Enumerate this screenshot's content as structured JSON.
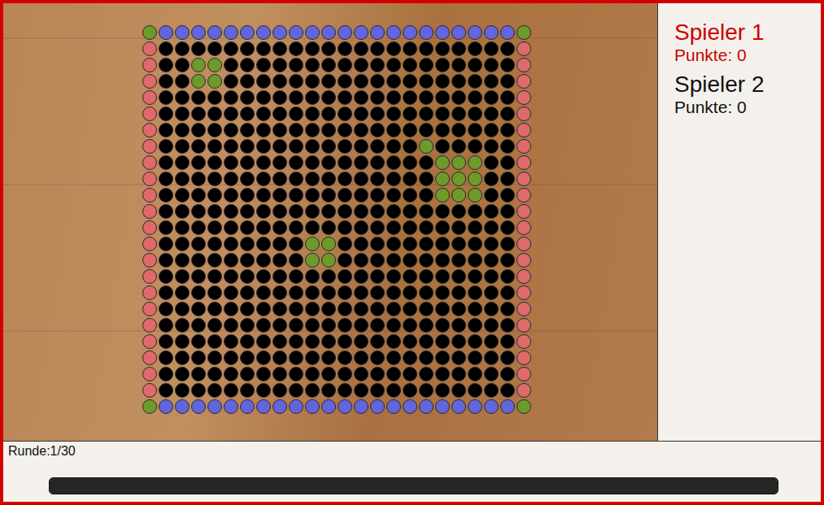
{
  "board": {
    "rows": [
      "gbbbbbbbbbbbbbbbbbbbbbbg",
      "r......................r",
      "r..gg..................r",
      "r..gg..................r",
      "r......................r",
      "r......................r",
      "r......................r",
      "r................g.....r",
      "r.................ggg..r",
      "r.................ggg..r",
      "r.................ggg..r",
      "r......................r",
      "r......................r",
      "r.........gg...........r",
      "r.........gg...........r",
      "r......................r",
      "r......................r",
      "r......................r",
      "r......................r",
      "r......................r",
      "r......................r",
      "r......................r",
      "r......................r",
      "gbbbbbbbbbbbbbbbbbbbbbbg"
    ],
    "legend": {
      "g": "#6e9a2b",
      "b": "#6464dc",
      "r": "#de6a6a",
      ".": "#000000"
    }
  },
  "players": [
    {
      "name": "Spieler 1",
      "points": "Punkte: 0",
      "active": true
    },
    {
      "name": "Spieler 2",
      "points": "Punkte: 0",
      "active": false
    }
  ],
  "round": "Runde:1/30",
  "timer": {
    "level": 1
  }
}
